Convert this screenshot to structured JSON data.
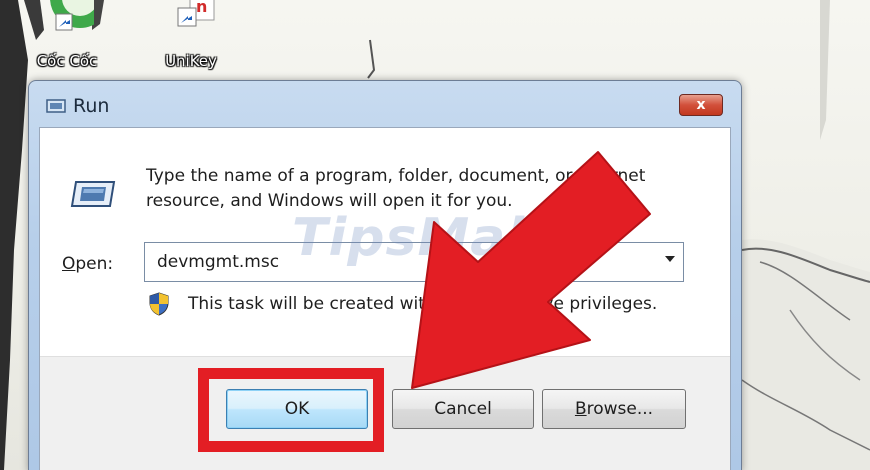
{
  "desktop": {
    "icons": [
      {
        "name": "coc-coc",
        "label": "Cốc Cốc"
      },
      {
        "name": "unikey",
        "label": "UniKey",
        "glyph": "n"
      }
    ]
  },
  "window": {
    "title": "Run",
    "close_glyph": "x",
    "description": "Type the name of a program, folder, document, or Internet resource, and Windows will open it for you.",
    "open_label_mnemonic": "O",
    "open_label_rest": "pen:",
    "open_value": "devmgmt.msc",
    "admin_note": "This task will be created with administrative privileges.",
    "buttons": {
      "ok": "OK",
      "cancel": "Cancel",
      "browse_mnemonic": "B",
      "browse_rest": "rowse..."
    }
  },
  "watermark": "TipsMake",
  "colors": {
    "highlight": "#e31e24",
    "arrow": "#e31e24"
  }
}
